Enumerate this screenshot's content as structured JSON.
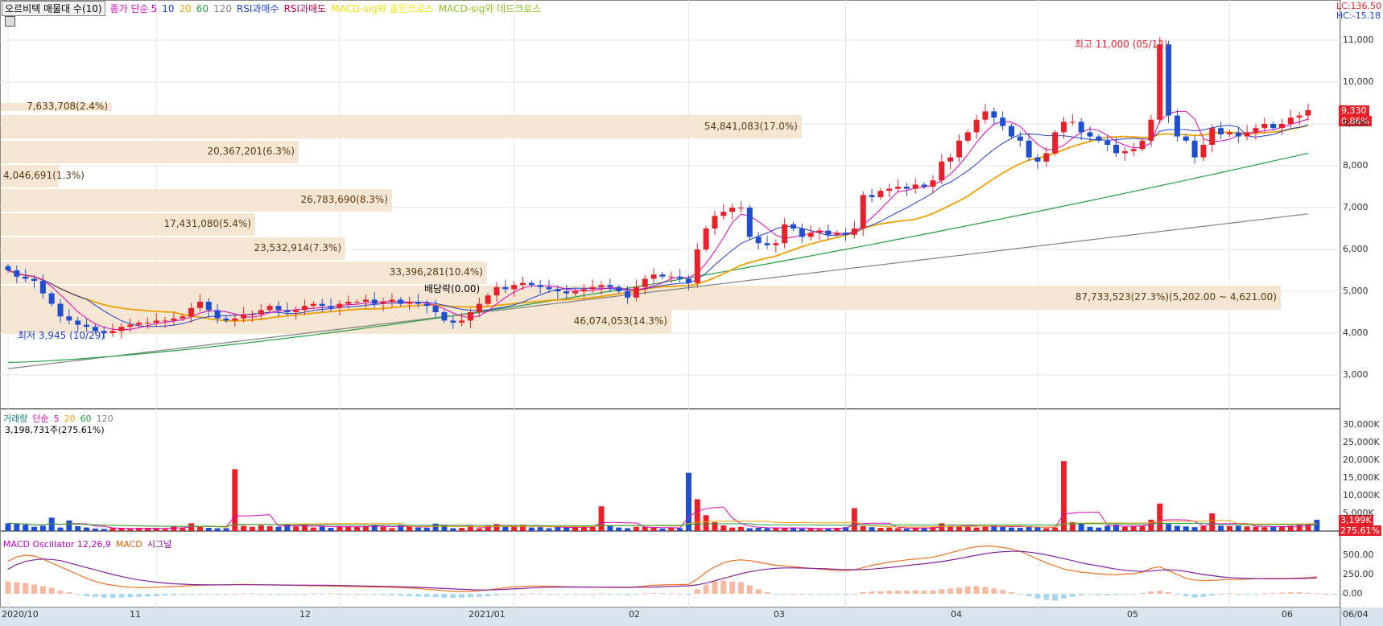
{
  "header": {
    "stock_name": "오르비텍 매물대 수(10)",
    "ma_label": "종가 단순",
    "ma_periods": [
      "5",
      "10",
      "20",
      "60",
      "120"
    ],
    "signals": [
      "RSI과매수",
      "RSI과매도",
      "MACD-sig와 골든크로스",
      "MACD-sig와 데드크로스"
    ],
    "right_lc": "LC:136.50",
    "right_hc": "HC:-15.18"
  },
  "volume_header": {
    "label": "거래량",
    "ma_label": "단순",
    "periods": [
      "5",
      "20",
      "60",
      "120"
    ],
    "last_value": "3,198,731주(275.61%)"
  },
  "macd_header": {
    "oscillator": "MACD Oscillator 12,26,9",
    "macd": "MACD",
    "signal": "시그널"
  },
  "colors": {
    "up": "#e8202a",
    "down": "#1f4fd0",
    "ma5": "#e000c0",
    "ma10": "#1f3fd0",
    "ma20": "#f0a000",
    "ma60": "#20a040",
    "ma120": "#808080",
    "volume_profile": "#f5e6d3",
    "macd_up": "#f5b8a0",
    "macd_down": "#a8d8f0"
  },
  "annotations": {
    "high": "최고 11,000 (05/12)",
    "low": "최저 3,945 (10/29)",
    "dividend": "배당락(0.00)",
    "last_price": "9,330",
    "last_change": "0.86%",
    "vol_last": "3,199K",
    "vol_pct": "275.61%"
  },
  "chart_data": {
    "type": "candlestick",
    "price_axis": {
      "ticks": [
        "3,000",
        "4,000",
        "5,000",
        "6,000",
        "7,000",
        "8,000",
        "9,000",
        "10,000",
        "11,000"
      ]
    },
    "volume_axis": {
      "ticks": [
        "30,000K",
        "25,000K",
        "20,000K",
        "15,000K",
        "10,000K",
        "5,000K"
      ]
    },
    "macd_axis": {
      "ticks": [
        "500.00",
        "250.00",
        "0.00"
      ]
    },
    "x_labels": [
      "2020/10",
      "11",
      "12",
      "2021/01",
      "02",
      "03",
      "04",
      "05",
      "06",
      "06/04"
    ],
    "volume_profile": [
      {
        "label": "7,633,708(2.4%)"
      },
      {
        "label": "54,841,083(17.0%)"
      },
      {
        "label": "20,367,201(6.3%)"
      },
      {
        "label": "4,046,691(1.3%)"
      },
      {
        "label": "26,783,690(8.3%)"
      },
      {
        "label": "17,431,080(5.4%)"
      },
      {
        "label": "23,532,914(7.3%)"
      },
      {
        "label": "33,396,281(10.4%)"
      },
      {
        "label": "87,733,523(27.3%)(5,202.00 ~ 4,621.00)"
      },
      {
        "label": "46,074,053(14.3%)"
      }
    ],
    "price_series": [
      5500,
      5350,
      5300,
      5250,
      4950,
      4700,
      4400,
      4300,
      4200,
      4150,
      4050,
      4000,
      4050,
      4150,
      4200,
      4250,
      4250,
      4300,
      4300,
      4350,
      4400,
      4600,
      4750,
      4550,
      4350,
      4300,
      4350,
      4450,
      4450,
      4550,
      4650,
      4550,
      4500,
      4550,
      4650,
      4700,
      4650,
      4600,
      4700,
      4750,
      4750,
      4800,
      4700,
      4750,
      4800,
      4700,
      4750,
      4700,
      4650,
      4500,
      4300,
      4250,
      4300,
      4500,
      4700,
      4900,
      5100,
      5050,
      5150,
      5200,
      5150,
      5100,
      5050,
      5000,
      4950,
      5000,
      5050,
      5100,
      5150,
      5100,
      5000,
      4850,
      5100,
      5300,
      5400,
      5350,
      5350,
      5300,
      5200,
      6000,
      6500,
      6800,
      6900,
      7000,
      7000,
      6300,
      6150,
      6100,
      6150,
      6600,
      6500,
      6300,
      6400,
      6450,
      6350,
      6400,
      6350,
      6500,
      7300,
      7250,
      7400,
      7450,
      7500,
      7450,
      7550,
      7500,
      7650,
      8100,
      8200,
      8600,
      8800,
      9100,
      9300,
      9150,
      8950,
      8700,
      8600,
      8200,
      8100,
      8300,
      8800,
      9050,
      9050,
      8800,
      8700,
      8600,
      8500,
      8300,
      8350,
      8400,
      8600,
      9100,
      10900,
      9200,
      8700,
      8600,
      8200,
      8500,
      8900,
      8750,
      8800,
      8700,
      8800,
      8900,
      9000,
      8900,
      9000,
      9150,
      9200,
      9330
    ],
    "ohlc": {
      "ma5": true,
      "ma10": true,
      "ma20": true,
      "ma60": true,
      "ma120": true
    },
    "volume_series": [
      2200,
      2000,
      1800,
      1200,
      1500,
      3800,
      1000,
      3000,
      1400,
      1000,
      700,
      600,
      800,
      900,
      600,
      900,
      800,
      700,
      600,
      1500,
      1000,
      2200,
      1300,
      900,
      800,
      800,
      17500,
      1500,
      1200,
      1600,
      1400,
      1200,
      1800,
      1300,
      1700,
      1000,
      1300,
      900,
      1400,
      1400,
      1200,
      1400,
      1600,
      1200,
      800,
      1600,
      1400,
      1000,
      900,
      2100,
      1800,
      800,
      900,
      1300,
      800,
      1500,
      2000,
      1200,
      1500,
      1800,
      1000,
      1100,
      800,
      1200,
      1000,
      1200,
      1400,
      1200,
      7000,
      1500,
      1000,
      800,
      1200,
      1200,
      900,
      700,
      900,
      800,
      16500,
      9000,
      4500,
      2500,
      1600,
      1000,
      1200,
      800,
      900,
      800,
      900,
      800,
      1000,
      700,
      700,
      600,
      700,
      900,
      1100,
      6500,
      1400,
      1100,
      900,
      1000,
      800,
      700,
      900,
      800,
      1200,
      2200,
      1500,
      1300,
      1200,
      1000,
      1500,
      1600,
      1200,
      1000,
      900,
      1400,
      1200,
      800,
      1000,
      19800,
      2500,
      2200,
      1200,
      1000,
      1500,
      1800,
      1200,
      1400,
      1500,
      3200,
      7800,
      2000,
      1500,
      1300,
      1100,
      1400,
      5000,
      1500,
      1400,
      1500,
      1300,
      1200,
      1100,
      1200,
      1400,
      1500,
      1700,
      1800,
      3199
    ],
    "macd_hist": [
      160,
      150,
      140,
      120,
      100,
      80,
      40,
      20,
      -10,
      -30,
      -40,
      -50,
      -55,
      -50,
      -45,
      -40,
      -35,
      -30,
      -25,
      -20,
      -15,
      -10,
      -5,
      -5,
      -5,
      -5,
      0,
      5,
      5,
      0,
      -5,
      -5,
      -5,
      0,
      0,
      5,
      5,
      5,
      0,
      0,
      0,
      -5,
      -10,
      -15,
      -20,
      -25,
      -30,
      -35,
      -40,
      -45,
      -50,
      -55,
      -50,
      -45,
      -40,
      -30,
      -20,
      -10,
      -5,
      0,
      5,
      5,
      0,
      -5,
      -5,
      0,
      0,
      0,
      5,
      -5,
      -10,
      -15,
      -5,
      5,
      10,
      10,
      5,
      0,
      -5,
      60,
      120,
      160,
      170,
      160,
      150,
      110,
      60,
      20,
      -10,
      -10,
      0,
      0,
      -5,
      -5,
      -10,
      -10,
      -5,
      0,
      20,
      30,
      35,
      40,
      40,
      40,
      45,
      40,
      45,
      60,
      70,
      80,
      95,
      100,
      90,
      70,
      50,
      20,
      -10,
      -30,
      -60,
      -80,
      -90,
      -60,
      -40,
      -20,
      -10,
      -15,
      -20,
      -15,
      -10,
      0,
      10,
      30,
      40,
      20,
      -10,
      -30,
      -50,
      -40,
      -20,
      0,
      5,
      0,
      -10,
      -5,
      5,
      10,
      15,
      20,
      20,
      10,
      5,
      0,
      -5,
      -10
    ],
    "macd_line": [
      420,
      480,
      500,
      490,
      450,
      400,
      350,
      300,
      250,
      200,
      160,
      130,
      110,
      95,
      85,
      80,
      80,
      85,
      90,
      95,
      100,
      105,
      110,
      112,
      115,
      118,
      120,
      122,
      120,
      118,
      115,
      112,
      110,
      108,
      106,
      104,
      102,
      100,
      98,
      95,
      92,
      90,
      88,
      86,
      84,
      80,
      75,
      70,
      60,
      50,
      40,
      30,
      28,
      30,
      40,
      50,
      65,
      80,
      90,
      95,
      100,
      100,
      98,
      95,
      92,
      90,
      88,
      86,
      84,
      82,
      80,
      82,
      90,
      100,
      110,
      115,
      118,
      120,
      122,
      190,
      280,
      350,
      400,
      430,
      440,
      430,
      410,
      390,
      370,
      360,
      350,
      340,
      330,
      320,
      310,
      300,
      300,
      310,
      340,
      370,
      390,
      410,
      425,
      440,
      450,
      460,
      475,
      500,
      530,
      560,
      590,
      610,
      620,
      615,
      600,
      580,
      550,
      500,
      450,
      400,
      360,
      320,
      300,
      280,
      270,
      260,
      250,
      250,
      255,
      260,
      280,
      330,
      350,
      300,
      250,
      200,
      180,
      170,
      175,
      180,
      185,
      185,
      190,
      195,
      200,
      200,
      200,
      200,
      205,
      210,
      220
    ],
    "signal_line": [
      320,
      380,
      420,
      440,
      450,
      445,
      430,
      400,
      370,
      340,
      310,
      280,
      250,
      225,
      200,
      180,
      165,
      150,
      140,
      130,
      125,
      120,
      118,
      117,
      117,
      117,
      118,
      118,
      118,
      117,
      116,
      115,
      114,
      113,
      112,
      111,
      110,
      109,
      107,
      105,
      103,
      101,
      99,
      97,
      95,
      92,
      88,
      84,
      79,
      74,
      69,
      64,
      58,
      53,
      50,
      50,
      53,
      58,
      64,
      70,
      76,
      81,
      85,
      87,
      88,
      88,
      88,
      87,
      86,
      85,
      84,
      83,
      84,
      86,
      88,
      92,
      96,
      100,
      104,
      116,
      140,
      170,
      200,
      230,
      260,
      285,
      305,
      320,
      330,
      335,
      335,
      333,
      330,
      327,
      323,
      318,
      315,
      313,
      314,
      320,
      330,
      340,
      352,
      365,
      378,
      390,
      402,
      418,
      436,
      456,
      478,
      500,
      520,
      535,
      545,
      550,
      550,
      540,
      525,
      505,
      480,
      455,
      430,
      400,
      380,
      360,
      340,
      320,
      305,
      295,
      290,
      295,
      305,
      310,
      305,
      290,
      270,
      250,
      235,
      220,
      210,
      205,
      200,
      197,
      195,
      195,
      195,
      196,
      197,
      200,
      205
    ]
  }
}
